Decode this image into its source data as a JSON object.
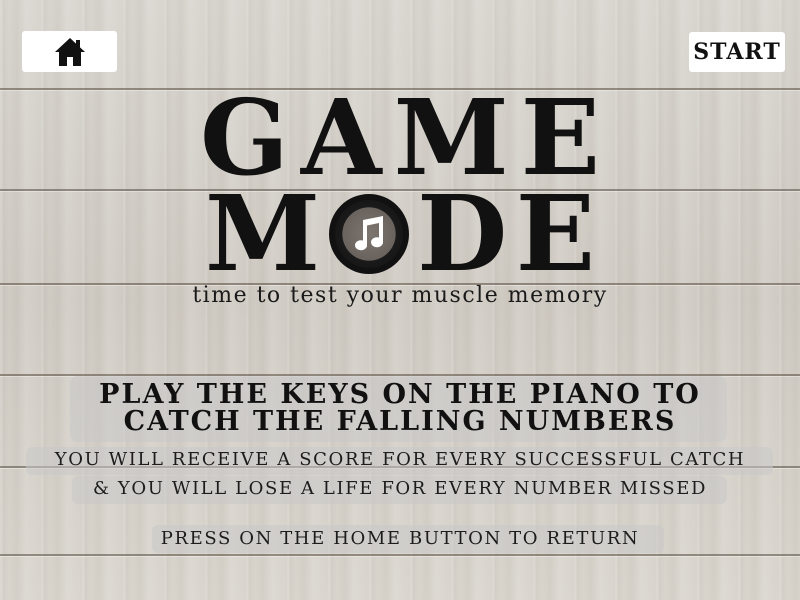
{
  "toolbar": {
    "home_icon": "home-icon",
    "start_label": "START"
  },
  "title": {
    "line1": [
      "G",
      "A",
      "M",
      "E"
    ],
    "line2": [
      "M",
      "D",
      "E"
    ],
    "disc_icon": "music-note-icon",
    "subtitle": "time to test your muscle memory"
  },
  "instructions": {
    "heading_line1": "PLAY THE KEYS ON THE PIANO TO",
    "heading_line2": "CATCH THE FALLING NUMBERS",
    "detail_line1": "YOU WILL RECEIVE A SCORE FOR EVERY SUCCESSFUL CATCH",
    "detail_line2": "& YOU WILL LOSE A LIFE FOR EVERY NUMBER MISSED",
    "return_hint": "PRESS ON THE HOME BUTTON TO RETURN"
  },
  "colors": {
    "text": "#111111",
    "button_bg": "#ffffff",
    "disc_center": "#6f6862"
  }
}
